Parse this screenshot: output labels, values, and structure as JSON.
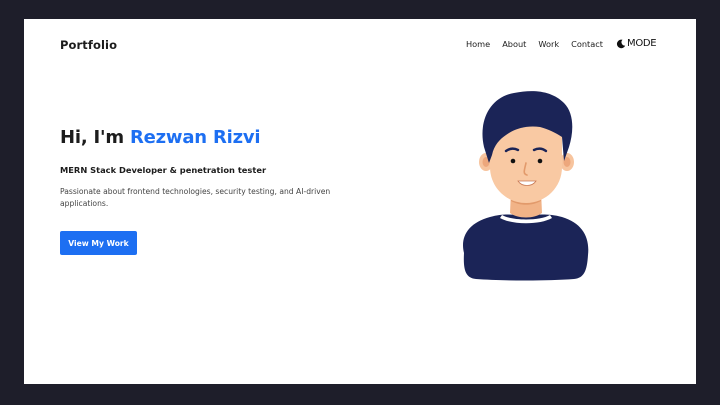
{
  "nav": {
    "brand": "Portfolio",
    "links": [
      "Home",
      "About",
      "Work",
      "Contact"
    ],
    "mode_label": "MODE",
    "mode_icon": "moon-icon"
  },
  "hero": {
    "greeting": "Hi, I'm",
    "name": "Rezwan Rizvi",
    "role": "MERN Stack Developer & penetration tester",
    "description": "Passionate about frontend technologies, security testing, and AI-driven applications.",
    "cta_label": "View My Work"
  },
  "colors": {
    "accent": "#1d6ff2",
    "background": "#ffffff",
    "outer": "#1e1e2a",
    "text": "#1c1c1c"
  },
  "avatar_icon": "avatar-illustration"
}
